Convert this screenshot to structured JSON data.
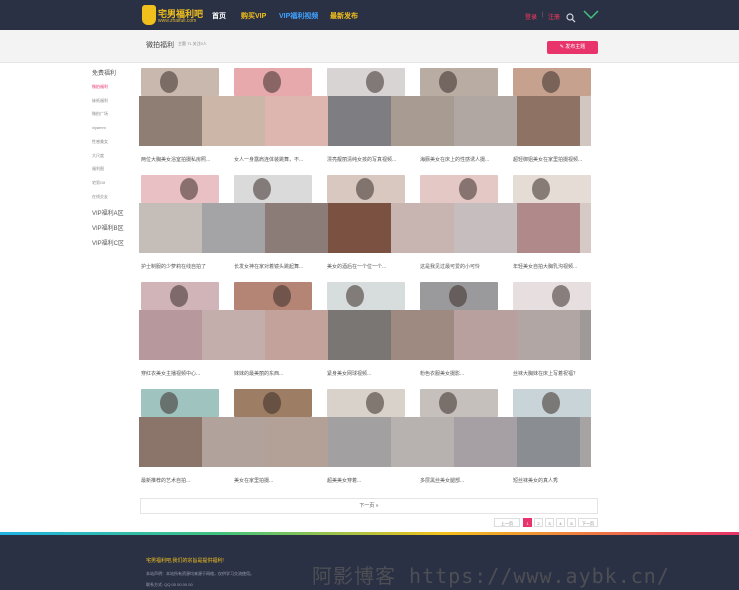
{
  "header": {
    "logo_text": "宅男福利吧",
    "logo_sub": "www.zhaifuli.com",
    "nav": [
      "首页",
      "购买VIP",
      "VIP福利视频",
      "最新发布"
    ],
    "login": "登录",
    "separator": "|",
    "register": "注册"
  },
  "subheader": {
    "title": "微拍福利",
    "meta": "主题 71 关注0人",
    "publish": "发布主题"
  },
  "sidebar": {
    "items": [
      {
        "label": "免费福利"
      },
      {
        "label": "微拍福利"
      },
      {
        "label": "妹纸福利"
      },
      {
        "label": "微拍广场"
      },
      {
        "label": "xiyamm"
      },
      {
        "label": "性感美女"
      },
      {
        "label": "大尺度"
      },
      {
        "label": "福利图"
      },
      {
        "label": "宅男Gif"
      },
      {
        "label": "在线交友"
      },
      {
        "label": "VIP福利A区"
      },
      {
        "label": "VIP福利B区"
      },
      {
        "label": "VIP福利C区"
      }
    ]
  },
  "cards": [
    {
      "caption": "两位大胸美女浴室拍摄私房照..."
    },
    {
      "caption": "女人一身露肩连体装跳舞，不..."
    },
    {
      "caption": "漂亮靓丽清纯女孩的写真视频..."
    },
    {
      "caption": "海豚美女在床上的性感诱人摄..."
    },
    {
      "caption": "超轻御姐美女在家里拍摄视频..."
    },
    {
      "caption": "护士制服的少萝莉在线自拍了"
    },
    {
      "caption": "长发女神在家对着镜头跳起舞..."
    },
    {
      "caption": "美女的酒后在一个位一个..."
    },
    {
      "caption": "这是我见过最可爱的小可怜"
    },
    {
      "caption": "年轻美女自拍大胸乳沟视频..."
    },
    {
      "caption": "穿红衣美女主播视频中心..."
    },
    {
      "caption": "妹妹的最美丽的东西..."
    },
    {
      "caption": "紧身美女网球视频..."
    },
    {
      "caption": "粉色衣服美女摄影..."
    },
    {
      "caption": "丝袜大胸妹在床上写着祝福？"
    },
    {
      "caption": "最新推荐的艺术自拍..."
    },
    {
      "caption": "美女在家里拍摄..."
    },
    {
      "caption": "超美美女穿着..."
    },
    {
      "caption": "多层黑丝美女腿部..."
    },
    {
      "caption": "短丝袜美女的真人秀"
    }
  ],
  "pagination": {
    "load_more": "下一页 »",
    "prev": "上一页",
    "pages": [
      "1",
      "2",
      "3",
      "4",
      "5"
    ],
    "next": "下一页"
  },
  "footer": {
    "title": "宅男福利吧,我们的宗旨是提供福利!",
    "text": "本站声明：本站所有资源均来源于网络，仅供学习交流使用。",
    "text2": "联系方式: QQ 00 00 00 00"
  },
  "watermark": "阿影博客 https://www.aybk.cn/",
  "colors": {
    "header_bg": "#2b3145",
    "accent_yellow": "#f2c01c",
    "accent_pink": "#e8336b",
    "accent_blue": "#3fa2ff"
  }
}
